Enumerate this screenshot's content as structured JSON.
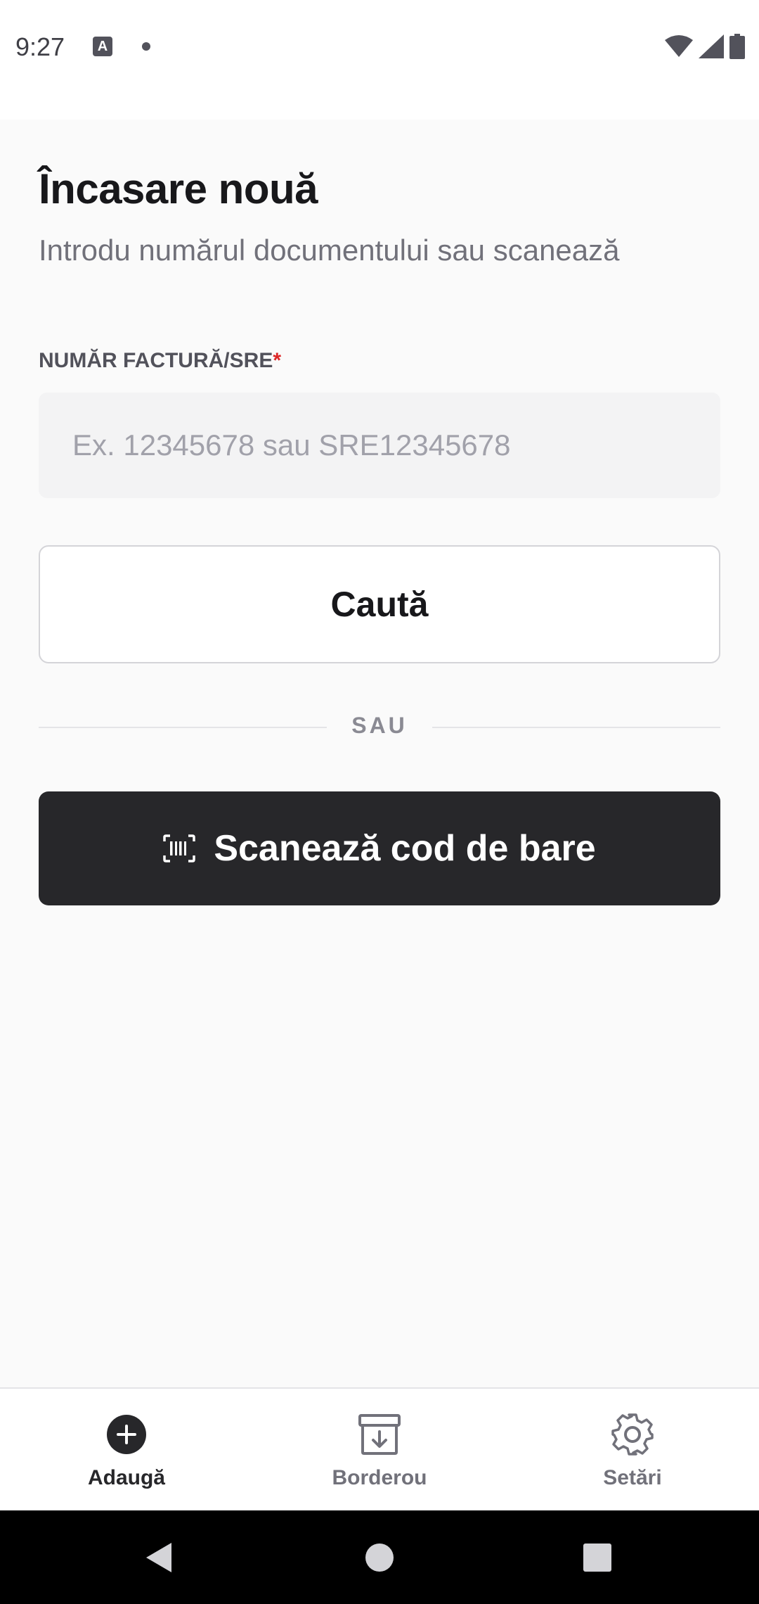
{
  "status_bar": {
    "time": "9:27",
    "notification_icon": "a-icon",
    "indicator_icon": "dot-icon",
    "right_icons": [
      "wifi-icon",
      "signal-icon",
      "battery-icon"
    ]
  },
  "page": {
    "title": "Încasare nouă",
    "subtitle": "Introdu numărul documentului sau scanează"
  },
  "form": {
    "invoice_label": "NUMĂR FACTURĂ/SRE",
    "required_mark": "*",
    "invoice_value": "",
    "invoice_placeholder": "Ex. 12345678 sau SRE12345678",
    "search_button": "Caută",
    "divider_text": "SAU",
    "scan_button": "Scanează cod de bare",
    "scan_icon": "barcode-icon"
  },
  "bottom_nav": {
    "items": [
      {
        "label": "Adaugă",
        "icon": "plus-circle-icon",
        "active": true
      },
      {
        "label": "Borderou",
        "icon": "archive-download-icon",
        "active": false
      },
      {
        "label": "Setări",
        "icon": "gear-icon",
        "active": false
      }
    ]
  },
  "system_nav": {
    "icons": [
      "back-icon",
      "home-icon",
      "recents-icon"
    ]
  },
  "colors": {
    "primary_dark": "#27272a",
    "background": "#fafafa",
    "required": "#dc2626",
    "muted_text": "#71717a"
  }
}
